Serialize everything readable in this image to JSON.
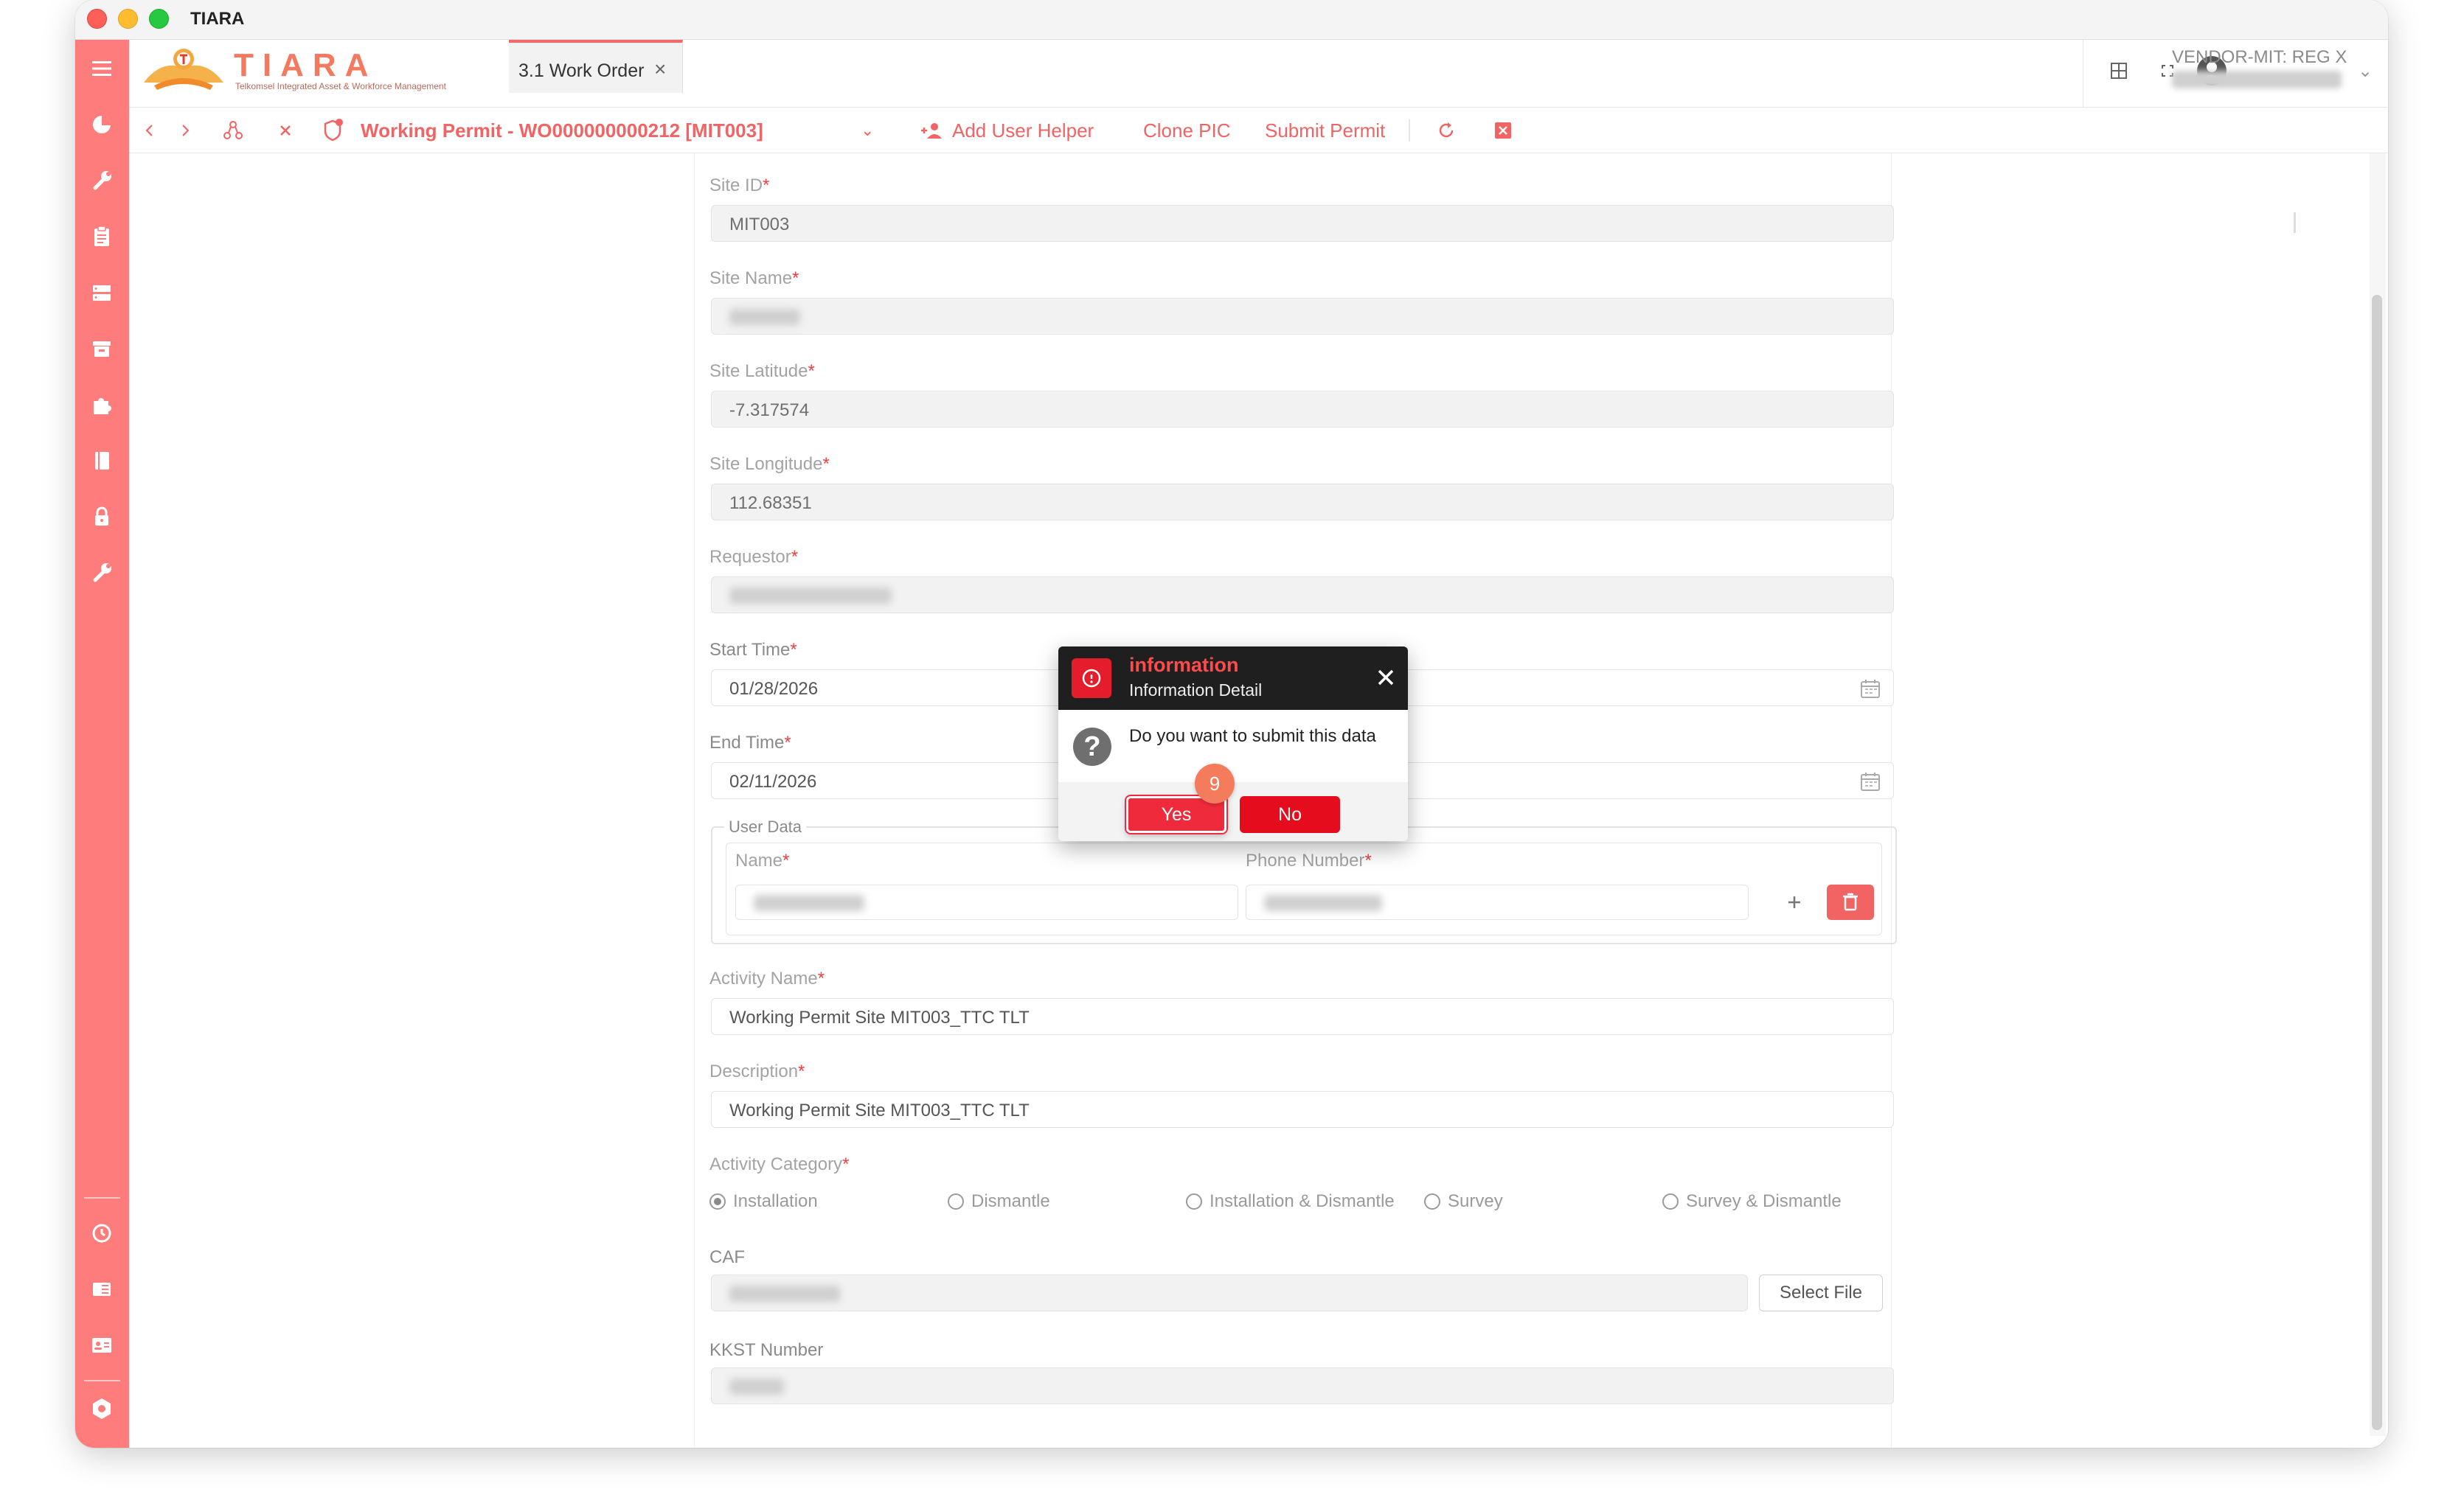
{
  "window": {
    "title": "TIARA"
  },
  "header": {
    "logo_text": "TIARA",
    "logo_tagline": "Telkomsel Integrated Asset & Workforce Management",
    "tab_label": "3.1 Work Order",
    "user_name": "VENDOR-MIT: REG X"
  },
  "toolbar": {
    "permit_title": "Working Permit - WO000000000212 [MIT003]",
    "add_user_helper": "Add User Helper",
    "clone_pic": "Clone PIC",
    "submit_permit": "Submit Permit"
  },
  "form": {
    "site_id": {
      "label": "Site ID",
      "value": "MIT003"
    },
    "site_name": {
      "label": "Site Name"
    },
    "site_latitude": {
      "label": "Site Latitude",
      "value": "-7.317574"
    },
    "site_longitude": {
      "label": "Site Longitude",
      "value": "112.68351"
    },
    "requestor": {
      "label": "Requestor"
    },
    "start_time": {
      "label": "Start Time",
      "value": "01/28/2026"
    },
    "end_time": {
      "label": "End Time",
      "value": "02/11/2026"
    },
    "user_data": {
      "legend": "User Data",
      "name_label": "Name",
      "phone_label": "Phone Number"
    },
    "activity_name": {
      "label": "Activity Name",
      "value": "Working Permit Site MIT003_TTC TLT"
    },
    "description": {
      "label": "Description",
      "value": "Working Permit Site MIT003_TTC TLT"
    },
    "activity_category": {
      "label": "Activity Category",
      "options": [
        "Installation",
        "Dismantle",
        "Installation & Dismantle",
        "Survey",
        "Survey & Dismantle"
      ],
      "selected": "Installation"
    },
    "caf": {
      "label": "CAF",
      "button": "Select File"
    },
    "kkst_number": {
      "label": "KKST Number"
    },
    "required_mark": "*"
  },
  "dialog": {
    "title": "information",
    "subtitle": "Information Detail",
    "message": "Do you want to submit this data",
    "yes": "Yes",
    "no": "No"
  },
  "step_badge": "9",
  "colors": {
    "sidebar": "#ff7c7c",
    "accent": "#f26363",
    "danger": "#e50d1d",
    "dialog_header": "#1f1f1f"
  }
}
